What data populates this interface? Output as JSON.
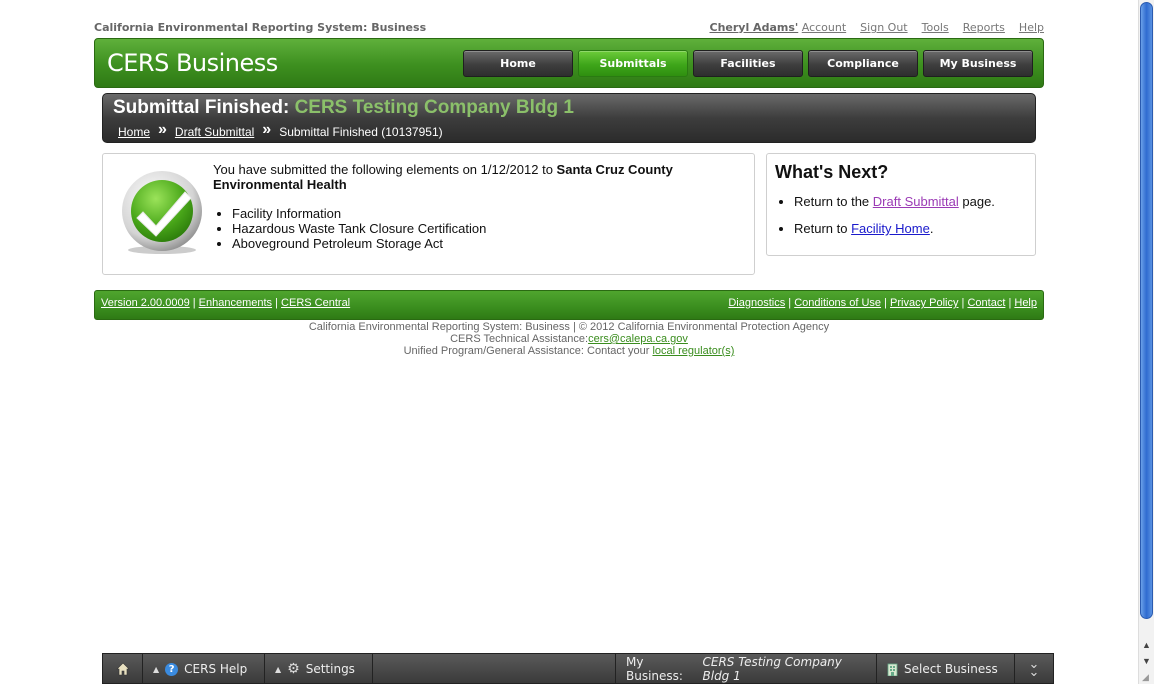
{
  "app": {
    "system_title": "California Environmental Reporting System: Business",
    "brand": "CERS Business"
  },
  "top_links": {
    "user_name": "Cheryl Adams'",
    "account": "Account",
    "sign_out": "Sign Out",
    "tools": "Tools",
    "reports": "Reports",
    "help": "Help"
  },
  "nav": [
    {
      "label": "Home",
      "active": false
    },
    {
      "label": "Submittals",
      "active": true
    },
    {
      "label": "Facilities",
      "active": false
    },
    {
      "label": "Compliance",
      "active": false
    },
    {
      "label": "My Business",
      "active": false
    }
  ],
  "page": {
    "title_prefix": "Submittal Finished:",
    "title_subject": "CERS Testing Company Bldg 1",
    "breadcrumbs": [
      {
        "label": "Home",
        "link": true
      },
      {
        "label": "Draft Submittal",
        "link": true
      },
      {
        "label": "Submittal Finished (10137951)",
        "link": false
      }
    ]
  },
  "summary": {
    "intro_text": "You have submitted the following elements on 1/12/2012 to ",
    "regulator": "Santa Cruz County Environmental Health",
    "elements": [
      "Facility Information",
      "Hazardous Waste Tank Closure Certification",
      "Aboveground Petroleum Storage Act"
    ]
  },
  "whats_next": {
    "title": "What's Next?",
    "item1_prefix": "Return to the ",
    "item1_link": "Draft Submittal",
    "item1_suffix": " page.",
    "item2_prefix": "Return to ",
    "item2_link": "Facility Home",
    "item2_suffix": "."
  },
  "footer": {
    "version": "Version 2.00.0009",
    "enhancements": "Enhancements",
    "cers_central": "CERS Central",
    "diagnostics": "Diagnostics",
    "conditions": "Conditions of Use",
    "privacy": "Privacy Policy",
    "contact": "Contact",
    "help": "Help",
    "copyright": "California Environmental Reporting System: Business | © 2012 California Environmental Protection Agency",
    "tech_assist_label": "CERS Technical Assistance:",
    "tech_assist_email": "cers@calepa.ca.gov",
    "unified_label": "Unified Program/General Assistance: Contact your ",
    "unified_link": "local regulator(s)"
  },
  "bottom_bar": {
    "cers_help": "CERS Help",
    "settings": "Settings",
    "my_business_label": "My Business:",
    "my_business_name": "CERS Testing Company Bldg 1",
    "select_business": "Select Business"
  },
  "colors": {
    "brand_green": "#3d8f1f",
    "active_nav": "#3ea51a",
    "title_accent": "#8bc06a",
    "dark_bar": "#3d3d3d"
  }
}
